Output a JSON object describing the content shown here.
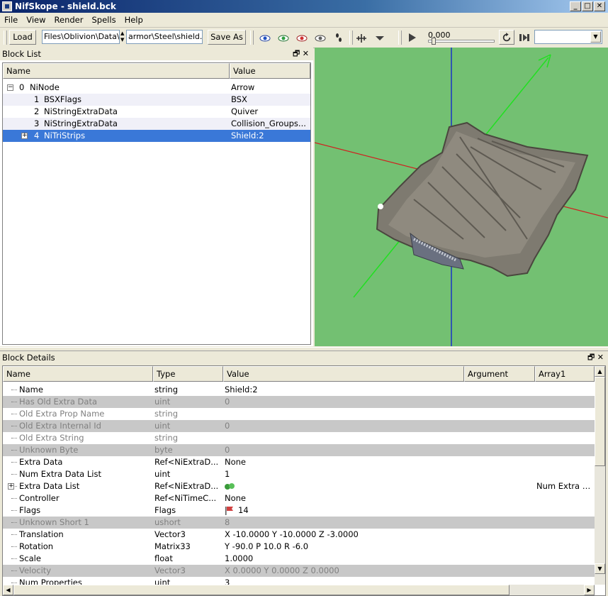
{
  "window": {
    "title": "NifSkope - shield.bck"
  },
  "menu": [
    {
      "label": "File"
    },
    {
      "label": "View"
    },
    {
      "label": "Render"
    },
    {
      "label": "Spells"
    },
    {
      "label": "Help"
    }
  ],
  "toolbar": {
    "load_label": "Load",
    "load_path": "Files\\Oblivion\\Data\\m",
    "save_path": "armor\\Steel\\shield.bck",
    "save_label": "Save As",
    "time_value": "0.000",
    "time_progress": 0.05,
    "animation_select": ""
  },
  "block_list": {
    "title": "Block List",
    "columns": [
      "Name",
      "Value"
    ],
    "rows": [
      {
        "index": "0",
        "name": "NiNode",
        "value": "Arrow"
      },
      {
        "index": "1",
        "name": "BSXFlags",
        "value": "BSX"
      },
      {
        "index": "2",
        "name": "NiStringExtraData",
        "value": "Quiver"
      },
      {
        "index": "3",
        "name": "NiStringExtraData",
        "value": "Collision_Groups..."
      },
      {
        "index": "4",
        "name": "NiTriStrips",
        "value": "Shield:2"
      }
    ]
  },
  "block_details": {
    "title": "Block Details",
    "columns": [
      "Name",
      "Type",
      "Value",
      "Argument",
      "Array1"
    ],
    "rows": [
      {
        "name": "Name",
        "type": "string",
        "value": "Shield:2",
        "array1": ""
      },
      {
        "name": "Has Old Extra Data",
        "type": "uint",
        "value": "0",
        "array1": ""
      },
      {
        "name": "Old Extra Prop Name",
        "type": "string",
        "value": "",
        "array1": ""
      },
      {
        "name": "Old Extra Internal Id",
        "type": "uint",
        "value": "0",
        "array1": ""
      },
      {
        "name": "Old Extra String",
        "type": "string",
        "value": "",
        "array1": ""
      },
      {
        "name": "Unknown Byte",
        "type": "byte",
        "value": "0",
        "array1": ""
      },
      {
        "name": "Extra Data",
        "type": "Ref<NiExtraD...",
        "value": "None",
        "array1": ""
      },
      {
        "name": "Num Extra Data List",
        "type": "uint",
        "value": "1",
        "array1": ""
      },
      {
        "name": "Extra Data List",
        "type": "Ref<NiExtraD...",
        "value": "",
        "array1": "Num Extra Data"
      },
      {
        "name": "Controller",
        "type": "Ref<NiTimeC...",
        "value": "None",
        "array1": ""
      },
      {
        "name": "Flags",
        "type": "Flags",
        "value": "14",
        "array1": ""
      },
      {
        "name": "Unknown Short 1",
        "type": "ushort",
        "value": "8",
        "array1": ""
      },
      {
        "name": "Translation",
        "type": "Vector3",
        "value": "X -10.0000 Y -10.0000 Z -3.0000",
        "array1": ""
      },
      {
        "name": "Rotation",
        "type": "Matrix33",
        "value": "Y -90.0 P 10.0 R -6.0",
        "array1": ""
      },
      {
        "name": "Scale",
        "type": "float",
        "value": "1.0000",
        "array1": ""
      },
      {
        "name": "Velocity",
        "type": "Vector3",
        "value": "X 0.0000 Y 0.0000 Z 0.0000",
        "array1": ""
      },
      {
        "name": "Num Properties",
        "type": "uint",
        "value": "3",
        "array1": ""
      }
    ]
  },
  "colors": {
    "selection": "#3a78d8",
    "viewport_bg": "#73c072",
    "disabled_row": "#c8c8c8"
  }
}
